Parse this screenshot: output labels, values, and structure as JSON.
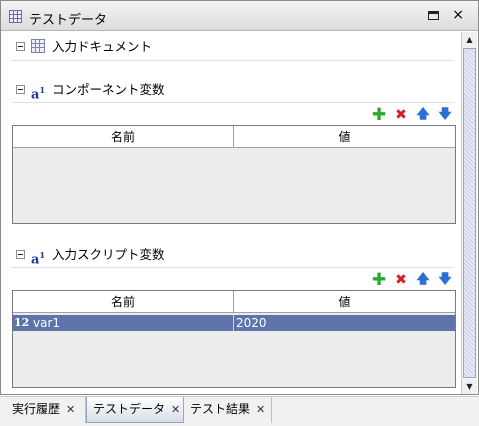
{
  "panel": {
    "title": "テストデータ",
    "restore_icon": "restore-icon",
    "close_glyph": "×"
  },
  "sections": {
    "input_docs": {
      "label": "入力ドキュメント",
      "icon": "grid-icon"
    },
    "component_vars": {
      "label": "コンポーネント変数",
      "icon": "variable-icon"
    },
    "script_vars": {
      "label": "入力スクリプト変数",
      "icon": "variable-icon"
    }
  },
  "icon_glyphs": {
    "var": "a",
    "var_sup": "1",
    "num": "12"
  },
  "actions": {
    "add": "✚",
    "delete": "✖",
    "up": "🡅",
    "down": "🡇"
  },
  "component_table": {
    "columns": [
      "名前",
      "値"
    ],
    "rows": []
  },
  "script_table": {
    "columns": [
      "名前",
      "値"
    ],
    "rows": [
      {
        "name": "var1",
        "value": "2020",
        "selected": true
      }
    ]
  },
  "scrollbar": {
    "up_glyph": "▲",
    "down_glyph": "▼"
  },
  "tabs": [
    {
      "label": "実行履歴",
      "active": false
    },
    {
      "label": "テストデータ",
      "active": true
    },
    {
      "label": "テスト結果",
      "active": false
    }
  ],
  "tab_close_glyph": "✕",
  "colors": {
    "selection": "#5d73a9",
    "add": "#2da82d",
    "delete": "#d81f1f",
    "move": "#2b6fd4"
  }
}
